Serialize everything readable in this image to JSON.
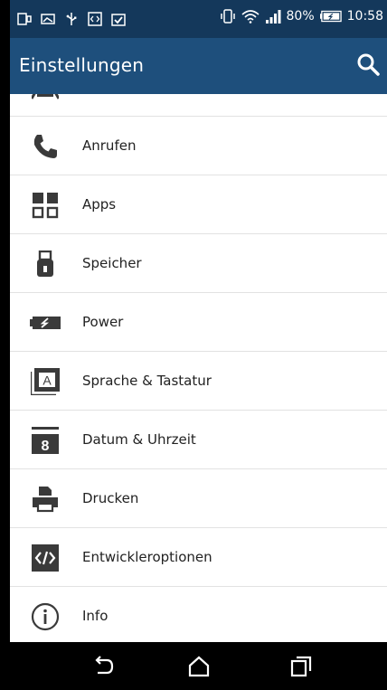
{
  "status_bar": {
    "battery_percent": "80%",
    "time": "10:58"
  },
  "app_bar": {
    "title": "Einstellungen",
    "search_icon": "search-icon"
  },
  "settings": [
    {
      "label": "Anrufen",
      "icon": "phone-icon"
    },
    {
      "label": "Apps",
      "icon": "apps-grid-icon"
    },
    {
      "label": "Speicher",
      "icon": "storage-usb-icon"
    },
    {
      "label": "Power",
      "icon": "battery-power-icon"
    },
    {
      "label": "Sprache & Tastatur",
      "icon": "language-keyboard-icon"
    },
    {
      "label": "Datum & Uhrzeit",
      "icon": "calendar-icon"
    },
    {
      "label": "Drucken",
      "icon": "printer-icon"
    },
    {
      "label": "Entwickleroptionen",
      "icon": "code-icon"
    },
    {
      "label": "Info",
      "icon": "info-icon"
    }
  ],
  "nav_bar": {
    "back": "back-icon",
    "home": "home-icon",
    "recents": "recents-icon"
  },
  "colors": {
    "status_bar": "#14385b",
    "app_bar": "#1e4f7c",
    "icon": "#3a3a3a"
  }
}
